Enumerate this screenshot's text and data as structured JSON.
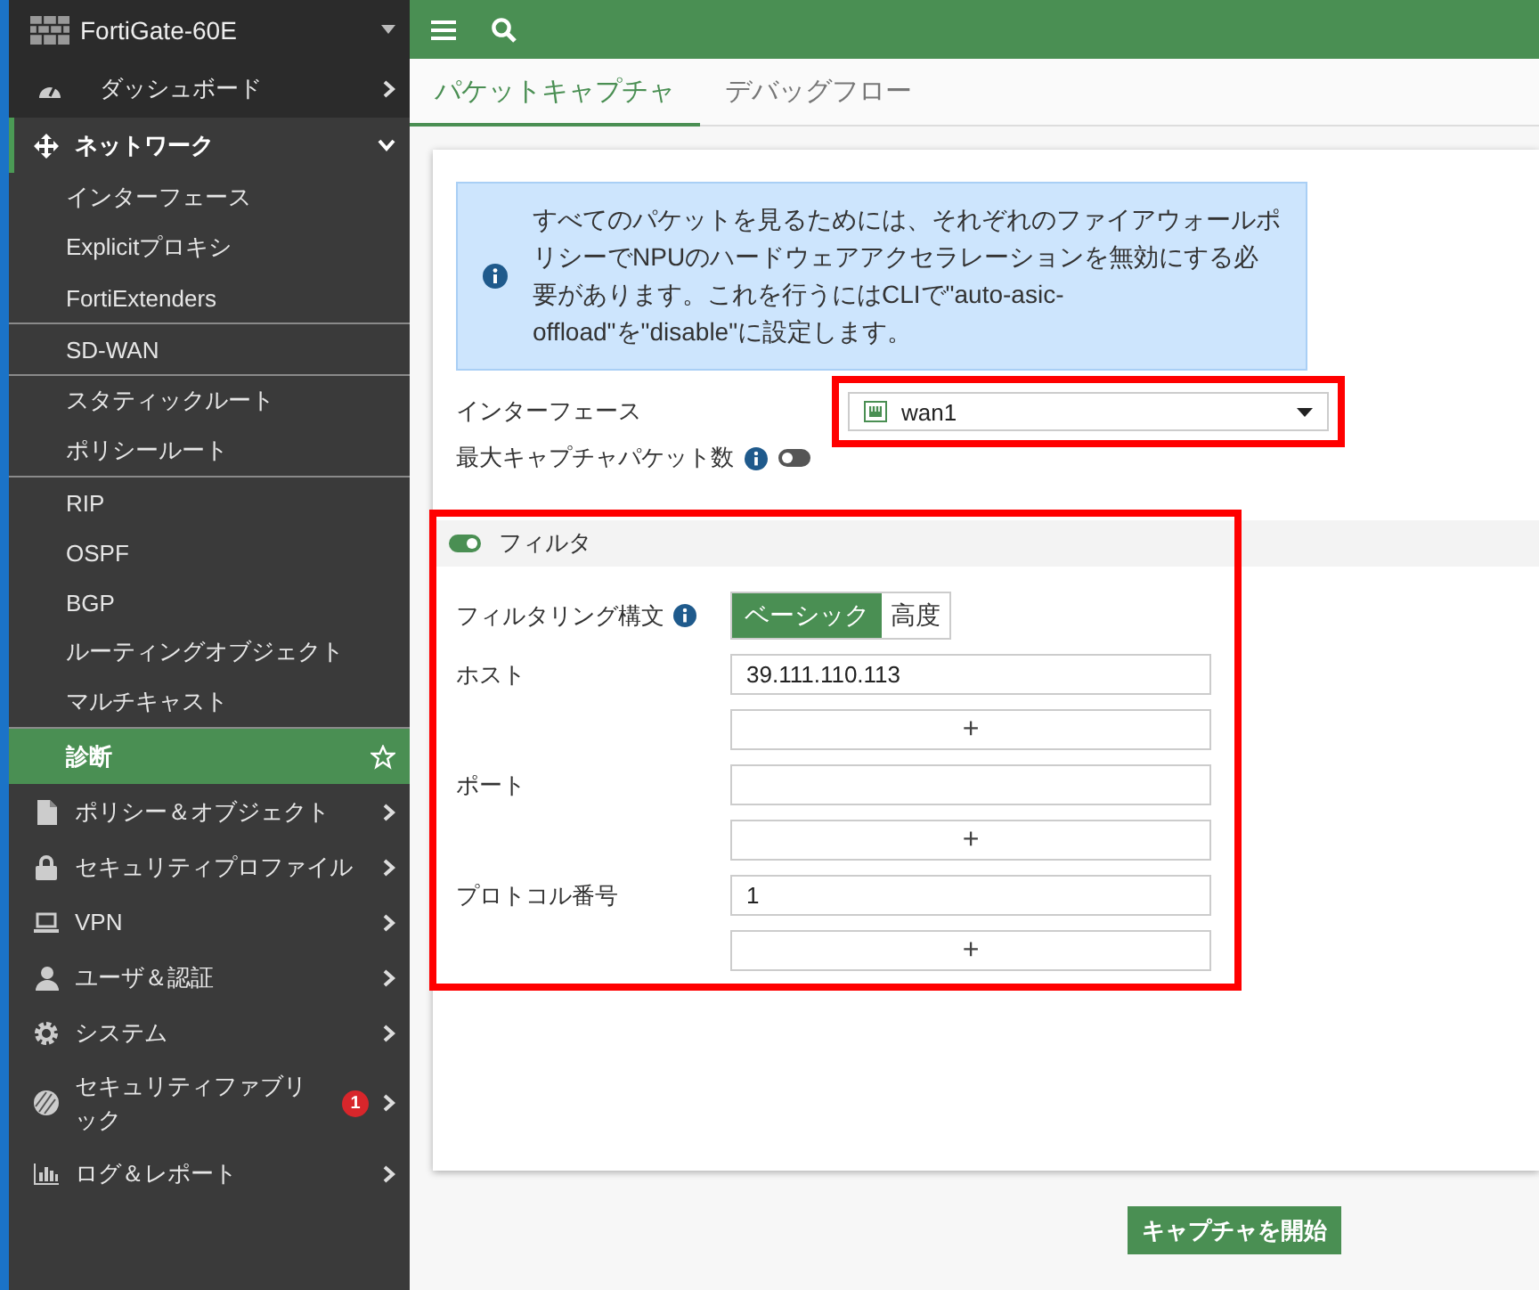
{
  "sidebar": {
    "device_name": "FortiGate-60E",
    "items": [
      {
        "label": "ダッシュボード",
        "expanded": false
      },
      {
        "label": "ネットワーク",
        "expanded": true,
        "children": [
          {
            "label": "インターフェース",
            "selected": false,
            "separator_before": false
          },
          {
            "label": "Explicitプロキシ",
            "selected": false,
            "separator_before": false
          },
          {
            "label": "FortiExtenders",
            "selected": false,
            "separator_before": false
          },
          {
            "label": "SD-WAN",
            "selected": false,
            "separator_before": true
          },
          {
            "label": "スタティックルート",
            "selected": false,
            "separator_before": true
          },
          {
            "label": "ポリシールート",
            "selected": false,
            "separator_before": false
          },
          {
            "label": "RIP",
            "selected": false,
            "separator_before": true
          },
          {
            "label": "OSPF",
            "selected": false,
            "separator_before": false
          },
          {
            "label": "BGP",
            "selected": false,
            "separator_before": false
          },
          {
            "label": "ルーティングオブジェクト",
            "selected": false,
            "separator_before": false
          },
          {
            "label": "マルチキャスト",
            "selected": false,
            "separator_before": false
          },
          {
            "label": "診断",
            "selected": true,
            "separator_before": true
          }
        ]
      },
      {
        "label": "ポリシー＆オブジェクト",
        "expanded": false
      },
      {
        "label": "セキュリティプロファイル",
        "expanded": false
      },
      {
        "label": "VPN",
        "expanded": false
      },
      {
        "label": "ユーザ＆認証",
        "expanded": false
      },
      {
        "label": "システム",
        "expanded": false
      },
      {
        "label": "セキュリティファブリック",
        "expanded": false,
        "badge": "1"
      },
      {
        "label": "ログ＆レポート",
        "expanded": false
      }
    ]
  },
  "tabs": [
    {
      "label": "パケットキャプチャ",
      "selected": true
    },
    {
      "label": "デバッグフロー",
      "selected": false
    }
  ],
  "info_box": {
    "text": "すべてのパケットを見るためには、それぞれのファイアウォールポリシーでNPUのハードウェアアクセラレーションを無効にする必要があります。これを行うにはCLIで\"auto-asic-offload\"を\"disable\"に設定します。"
  },
  "interface": {
    "label": "インターフェース",
    "value": "wan1",
    "highlighted": true
  },
  "max_packets": {
    "label": "最大キャプチャパケット数",
    "on": false
  },
  "filter": {
    "label": "フィルタ",
    "on": true,
    "highlighted": true,
    "syntax": {
      "label": "フィルタリング構文",
      "options": [
        {
          "label": "ベーシック",
          "selected": true
        },
        {
          "label": "高度",
          "selected": false
        }
      ]
    },
    "fields": [
      {
        "label": "ホスト",
        "value": "39.111.110.113",
        "add_button": "+"
      },
      {
        "label": "ポート",
        "add_button": "+"
      },
      {
        "label": "プロトコル番号",
        "value": "1",
        "add_button": "+"
      }
    ]
  },
  "start_button": "キャプチャを開始"
}
